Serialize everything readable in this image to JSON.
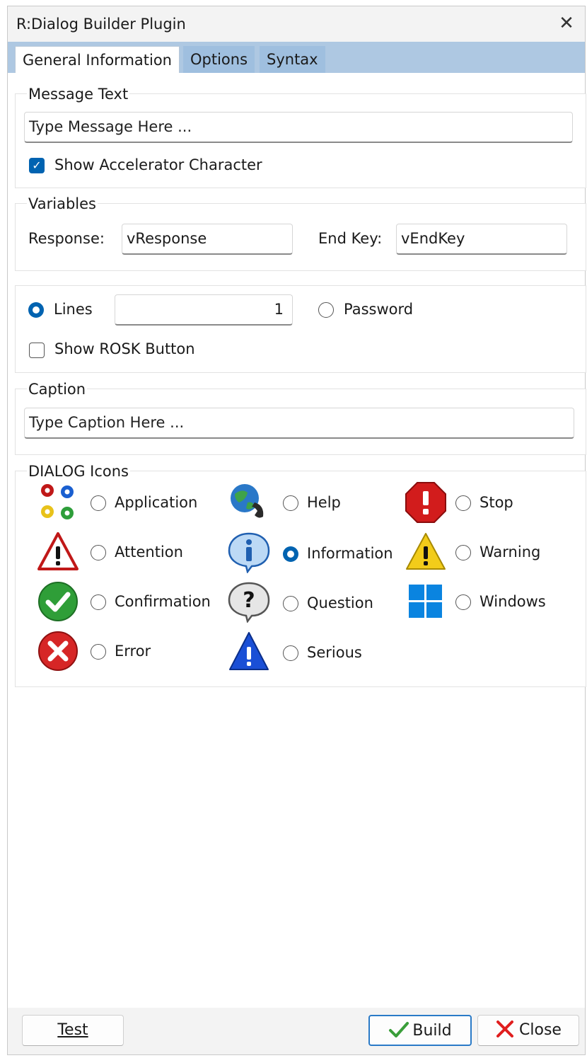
{
  "window": {
    "title": "R:Dialog Builder Plugin"
  },
  "tabs": [
    {
      "label": "General Information"
    },
    {
      "label": "Options"
    },
    {
      "label": "Syntax"
    }
  ],
  "message_text": {
    "legend": "Message Text",
    "placeholder": "Type Message Here ...",
    "accelerator_label": "Show Accelerator Character",
    "accelerator_checked": true
  },
  "variables": {
    "legend": "Variables",
    "response_label": "Response:",
    "response_value": "vResponse",
    "endkey_label": "End Key:",
    "endkey_value": "vEndKey"
  },
  "input_mode": {
    "lines_label": "Lines",
    "lines_value": "1",
    "lines_selected": true,
    "password_label": "Password",
    "password_selected": false,
    "rosk_label": "Show ROSK Button",
    "rosk_checked": false
  },
  "caption": {
    "legend": "Caption",
    "placeholder": "Type Caption Here ..."
  },
  "dialog_icons": {
    "legend": "DIALOG Icons",
    "selected": "Information",
    "items": [
      {
        "label": "Application",
        "icon": "gears-icon"
      },
      {
        "label": "Help",
        "icon": "globe-phone-icon"
      },
      {
        "label": "Stop",
        "icon": "stop-icon"
      },
      {
        "label": "Attention",
        "icon": "attention-icon"
      },
      {
        "label": "Information",
        "icon": "information-icon"
      },
      {
        "label": "Warning",
        "icon": "warning-icon"
      },
      {
        "label": "Confirmation",
        "icon": "checkmark-icon"
      },
      {
        "label": "Question",
        "icon": "question-icon"
      },
      {
        "label": "Windows",
        "icon": "windows-logo-icon"
      },
      {
        "label": "Error",
        "icon": "error-icon"
      },
      {
        "label": "Serious",
        "icon": "serious-icon"
      }
    ]
  },
  "footer": {
    "test_label": "Test",
    "build_label": "Build",
    "close_label": "Close"
  },
  "colors": {
    "accent": "#0063b1",
    "tabstrip": "#aec8e2"
  }
}
